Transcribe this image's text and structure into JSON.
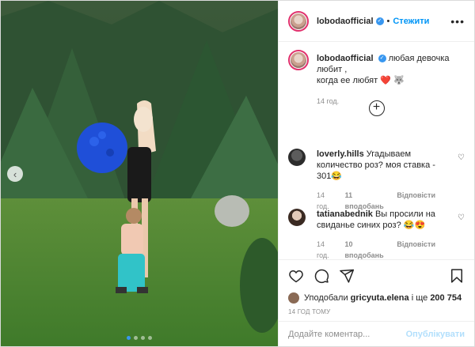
{
  "post": {
    "username": "lobodaofficial",
    "follow_label": "Стежити",
    "separator": "•",
    "more_label": "•••",
    "caption": {
      "username": "lobodaofficial",
      "text": "любая девочка\nлюбит ,\nкогда ее любят ❤️ 🐺",
      "time": "14 год."
    },
    "comments": [
      {
        "username": "loverly.hills",
        "text": "Угадываем количество роз? моя ставка - 301😂",
        "time": "14 год.",
        "likes": "11 вподобань",
        "reply": "Відповісти"
      },
      {
        "username": "tatianabednik",
        "text": "Вы просили на свиданье синих роз? 😂😍",
        "time": "14 год.",
        "likes": "10 вподобань",
        "reply": "Відповісти"
      }
    ],
    "likes": {
      "prefix": "Уподобали",
      "user": "gricyuta.elena",
      "middle": "і ще",
      "count": "200 754"
    },
    "posted_ago": "14 ГОД ТОМУ",
    "comment_placeholder": "Додайте коментар...",
    "publish_label": "Опублікувати",
    "carousel": {
      "count": 4,
      "active": 1
    }
  },
  "icons": {
    "like": "heart-icon",
    "comment": "comment-icon",
    "share": "share-icon",
    "save": "bookmark-icon",
    "load_more": "plus-circle-icon"
  },
  "colors": {
    "accent": "#0095f6",
    "publish_disabled": "#b2dffc",
    "verified": "#3897f0"
  }
}
